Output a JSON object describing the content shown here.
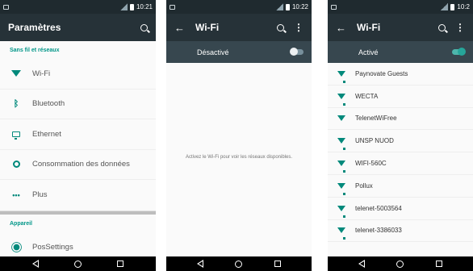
{
  "screen1": {
    "status_time": "10:21",
    "title": "Paramètres",
    "section_wireless": "Sans fil et réseaux",
    "items": [
      {
        "label": "Wi-Fi",
        "icon": "wifi-icon"
      },
      {
        "label": "Bluetooth",
        "icon": "bluetooth-icon"
      },
      {
        "label": "Ethernet",
        "icon": "ethernet-icon"
      },
      {
        "label": "Consommation des données",
        "icon": "data-usage-icon"
      },
      {
        "label": "Plus",
        "icon": "more-dots-icon"
      }
    ],
    "section_device": "Appareil",
    "device_items": [
      {
        "label": "PosSettings",
        "icon": "gear-icon"
      }
    ]
  },
  "screen2": {
    "status_time": "10:22",
    "title": "Wi-Fi",
    "toggle_label": "Désactivé",
    "toggle_on": false,
    "empty_message": "Activez le Wi-Fi pour voir les réseaux disponibles."
  },
  "screen3": {
    "status_time": "10:2",
    "title": "Wi-Fi",
    "toggle_label": "Activé",
    "toggle_on": true,
    "networks": [
      "Paynovate Guests",
      "WECTA",
      "TelenetWiFree",
      "UNSP NUOD",
      "WIFI-560C",
      "Pollux",
      "telenet-5003564",
      "telenet-3386033"
    ]
  },
  "colors": {
    "accent": "#009688",
    "appbar": "#263238",
    "togglebar": "#37474f",
    "statusbar": "#1f2a2f"
  }
}
